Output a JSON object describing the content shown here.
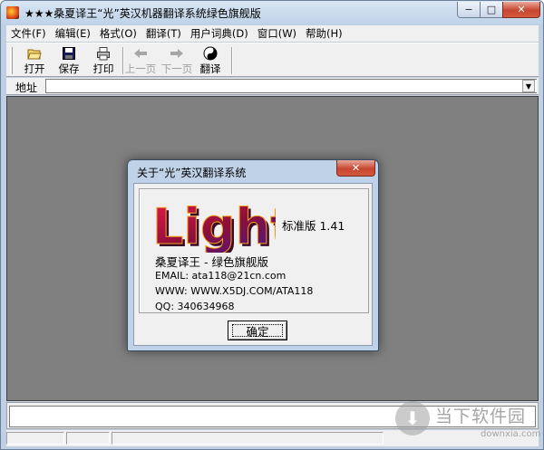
{
  "window": {
    "title": "★★★桑夏译王“光”英汉机器翻译系统绿色旗舰版",
    "min_label": "−",
    "max_label": "□",
    "close_label": "✕"
  },
  "menu": [
    {
      "label": "文件(F)",
      "name": "menu-file"
    },
    {
      "label": "编辑(E)",
      "name": "menu-edit"
    },
    {
      "label": "格式(O)",
      "name": "menu-format"
    },
    {
      "label": "翻译(T)",
      "name": "menu-translate"
    },
    {
      "label": "用户词典(D)",
      "name": "menu-user-dict"
    },
    {
      "label": "窗口(W)",
      "name": "menu-window"
    },
    {
      "label": "帮助(H)",
      "name": "menu-help"
    }
  ],
  "toolbar": {
    "open": {
      "label": "打开",
      "icon": "open-folder-icon",
      "glyph": "📂"
    },
    "save": {
      "label": "保存",
      "icon": "floppy-disk-icon",
      "glyph": "💾"
    },
    "print": {
      "label": "打印",
      "icon": "printer-icon",
      "glyph": "🖨"
    },
    "prev": {
      "label": "上一页",
      "icon": "arrow-left-icon",
      "glyph": "⬅",
      "disabled": true
    },
    "next": {
      "label": "下一页",
      "icon": "arrow-right-icon",
      "glyph": "➡",
      "disabled": true
    },
    "translate": {
      "label": "翻译",
      "icon": "yin-yang-icon",
      "glyph": "☯"
    }
  },
  "address": {
    "label": "地址",
    "value": ""
  },
  "dialog": {
    "title": "关于“光”英汉翻译系统",
    "close_label": "✕",
    "logo_text": "Light",
    "version": "标准版 1.41",
    "product": "桑夏译王 - 绿色旗舰版",
    "email": "EMAIL: ata118@21cn.com",
    "www": "WWW: WWW.X5DJ.COM/ATA118",
    "qq": "QQ: 340634968",
    "ok_label": "确定"
  },
  "watermark": {
    "text": "当下软件园",
    "url": "downxia.com"
  },
  "colors": {
    "workspace": "#808080",
    "chrome": "#f0f0f0",
    "frame": "#bfd2e8",
    "close_red": "#c7462f",
    "logo_red": "#c4122f"
  }
}
